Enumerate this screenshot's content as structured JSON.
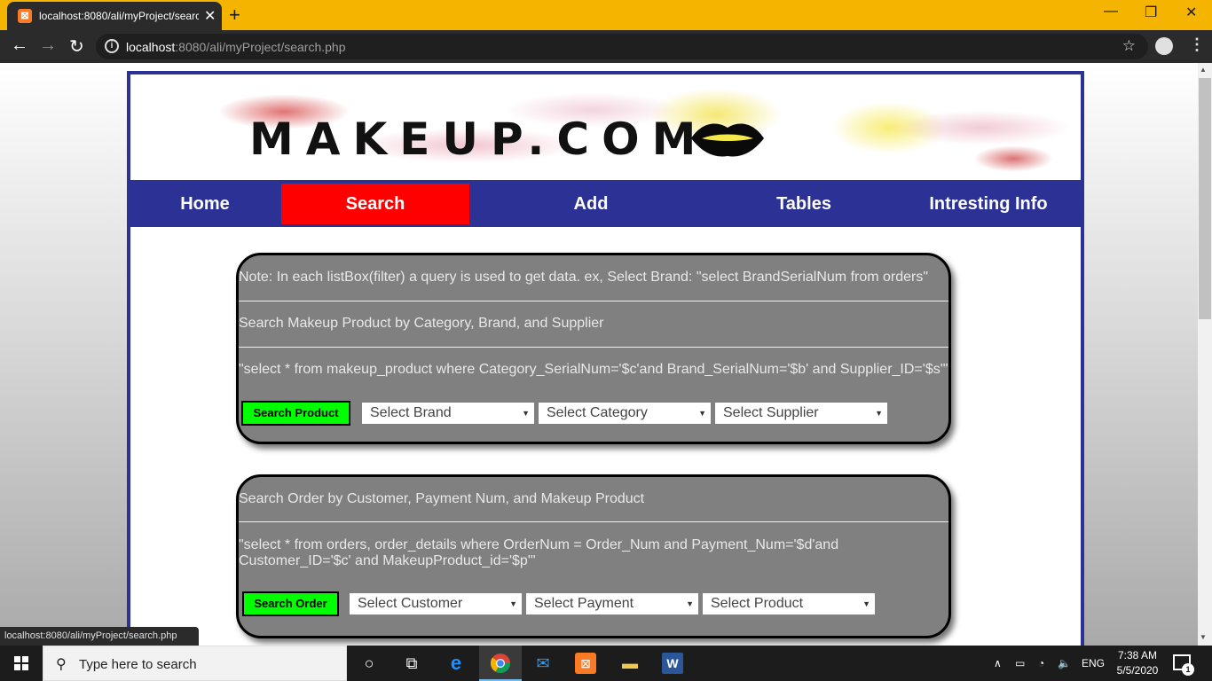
{
  "browser": {
    "tab_title": "localhost:8080/ali/myProject/search.php",
    "tab_favicon": "xampp-icon",
    "url_host": "localhost",
    "url_rest": ":8080/ali/myProject/search.php",
    "status_url": "localhost:8080/ali/myProject/search.php"
  },
  "site": {
    "logo_text": "MAKEUP.COM",
    "nav": [
      {
        "label": "Home"
      },
      {
        "label": "Search",
        "active": true
      },
      {
        "label": "Add"
      },
      {
        "label": "Tables"
      },
      {
        "label": "Intresting Info"
      }
    ],
    "active_color": "#ff0000",
    "nav_color": "#2c3295",
    "button_color": "#00ff00"
  },
  "product_panel": {
    "note": "Note: In each listBox(filter) a query is used to get data. ex, Select Brand: \"select BrandSerialNum from orders\"",
    "heading": "Search Makeup Product by Category, Brand, and Supplier",
    "query": "\"select * from makeup_product where Category_SerialNum='$c'and Brand_SerialNum='$b' and Supplier_ID='$s'\"",
    "button": "Search Product",
    "selects": [
      "Select Brand",
      "Select Category",
      "Select Supplier"
    ]
  },
  "order_panel": {
    "heading": "Search Order by Customer, Payment Num, and Makeup Product",
    "query_line1": "\"select * from orders, order_details where OrderNum = Order_Num and Payment_Num='$d'and",
    "query_line2": "Customer_ID='$c' and MakeupProduct_id='$p'\"",
    "button": "Search Order",
    "selects": [
      "Select Customer",
      "Select Payment",
      "Select Product"
    ]
  },
  "taskbar": {
    "search_placeholder": "Type here to search",
    "language": "ENG",
    "time": "7:38 AM",
    "date": "5/5/2020",
    "notification_count": "1"
  }
}
